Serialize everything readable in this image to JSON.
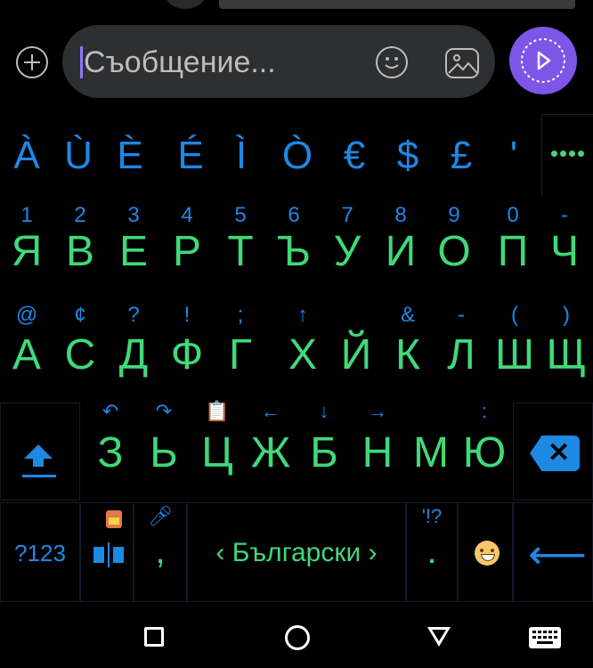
{
  "compose": {
    "placeholder": "Съобщение..."
  },
  "suggestions": [
    "À",
    "Ù",
    "È",
    "É",
    "Ì",
    "Ò",
    "€",
    "$",
    "£",
    "'"
  ],
  "row1": [
    {
      "main": "Я",
      "hint": "1"
    },
    {
      "main": "В",
      "hint": "2"
    },
    {
      "main": "Е",
      "hint": "3"
    },
    {
      "main": "Р",
      "hint": "4"
    },
    {
      "main": "Т",
      "hint": "5"
    },
    {
      "main": "Ъ",
      "hint": "6"
    },
    {
      "main": "У",
      "hint": "7"
    },
    {
      "main": "И",
      "hint": "8"
    },
    {
      "main": "О",
      "hint": "9"
    },
    {
      "main": "П",
      "hint": "0"
    },
    {
      "main": "Ч",
      "hint": "-"
    }
  ],
  "row2": [
    {
      "main": "А",
      "hint": "@"
    },
    {
      "main": "С",
      "hint": "¢"
    },
    {
      "main": "Д",
      "hint": "?"
    },
    {
      "main": "Ф",
      "hint": "!"
    },
    {
      "main": "Г",
      "hint": ";"
    },
    {
      "main": "Х",
      "hint": "↑"
    },
    {
      "main": "Й",
      "hint": ""
    },
    {
      "main": "К",
      "hint": "&"
    },
    {
      "main": "Л",
      "hint": "-"
    },
    {
      "main": "Ш",
      "hint": "("
    },
    {
      "main": "Щ",
      "hint": ")"
    }
  ],
  "row3": [
    {
      "main": "З",
      "hint": "↶"
    },
    {
      "main": "Ь",
      "hint": "↷"
    },
    {
      "main": "Ц",
      "hint": "📋"
    },
    {
      "main": "Ж",
      "hint": "←"
    },
    {
      "main": "Б",
      "hint": "↓"
    },
    {
      "main": "Н",
      "hint": "→"
    },
    {
      "main": "М",
      "hint": ""
    },
    {
      "main": "Ю",
      "hint": ":"
    }
  ],
  "bottom": {
    "symbols_label": "?123",
    "comma": ",",
    "space_label": "‹ Български ›",
    "period": ".",
    "period_hint": "'!?"
  }
}
